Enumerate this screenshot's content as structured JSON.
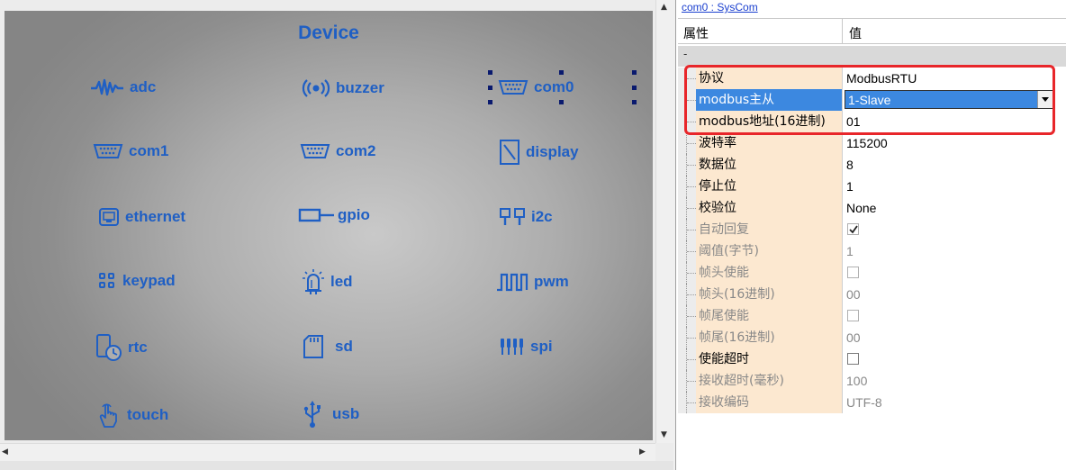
{
  "canvas": {
    "title": "Device",
    "devices": [
      {
        "id": "adc",
        "label": "adc",
        "icon": "waveform-icon"
      },
      {
        "id": "buzzer",
        "label": "buzzer",
        "icon": "speaker-icon"
      },
      {
        "id": "com0",
        "label": "com0",
        "icon": "serial-port-icon",
        "selected": true
      },
      {
        "id": "com1",
        "label": "com1",
        "icon": "serial-port-icon"
      },
      {
        "id": "com2",
        "label": "com2",
        "icon": "serial-port-icon"
      },
      {
        "id": "display",
        "label": "display",
        "icon": "display-icon"
      },
      {
        "id": "ethernet",
        "label": "ethernet",
        "icon": "ethernet-icon"
      },
      {
        "id": "gpio",
        "label": "gpio",
        "icon": "gpio-icon"
      },
      {
        "id": "i2c",
        "label": "i2c",
        "icon": "i2c-icon"
      },
      {
        "id": "keypad",
        "label": "keypad",
        "icon": "keypad-icon"
      },
      {
        "id": "led",
        "label": "led",
        "icon": "led-icon"
      },
      {
        "id": "pwm",
        "label": "pwm",
        "icon": "pwm-wave-icon"
      },
      {
        "id": "rtc",
        "label": "rtc",
        "icon": "clock-icon"
      },
      {
        "id": "sd",
        "label": "sd",
        "icon": "sd-card-icon"
      },
      {
        "id": "spi",
        "label": "spi",
        "icon": "spi-icon"
      },
      {
        "id": "touch",
        "label": "touch",
        "icon": "touch-hand-icon"
      },
      {
        "id": "usb",
        "label": "usb",
        "icon": "usb-icon"
      }
    ]
  },
  "property_grid": {
    "object_link": "com0 : SysCom",
    "header": {
      "name_col": "属性",
      "value_col": "值"
    },
    "category_label": "-",
    "rows": [
      {
        "name": "协议",
        "value": "ModbusRTU",
        "type": "text"
      },
      {
        "name": "modbus主从",
        "value": "1-Slave",
        "type": "dropdown",
        "selected": true
      },
      {
        "name": "modbus地址(16进制)",
        "value": "01",
        "type": "text"
      },
      {
        "name": "波特率",
        "value": "115200",
        "type": "text"
      },
      {
        "name": "数据位",
        "value": "8",
        "type": "text"
      },
      {
        "name": "停止位",
        "value": "1",
        "type": "text"
      },
      {
        "name": "校验位",
        "value": "None",
        "type": "text"
      },
      {
        "name": "自动回复",
        "value": "",
        "type": "checkbox",
        "checked": true,
        "disabled": true
      },
      {
        "name": "阈值(字节)",
        "value": "1",
        "type": "text",
        "disabled": true
      },
      {
        "name": "帧头使能",
        "value": "",
        "type": "checkbox",
        "checked": false,
        "disabled": true
      },
      {
        "name": "帧头(16进制)",
        "value": "00",
        "type": "text",
        "disabled": true
      },
      {
        "name": "帧尾使能",
        "value": "",
        "type": "checkbox",
        "checked": false,
        "disabled": true
      },
      {
        "name": "帧尾(16进制)",
        "value": "00",
        "type": "text",
        "disabled": true
      },
      {
        "name": "使能超时",
        "value": "",
        "type": "checkbox",
        "checked": false,
        "disabled": false
      },
      {
        "name": "接收超时(毫秒)",
        "value": "100",
        "type": "text",
        "disabled": true
      },
      {
        "name": "接收编码",
        "value": "UTF-8",
        "type": "text",
        "disabled": true
      }
    ]
  },
  "colors": {
    "accent": "#1f5fc4",
    "selection": "#3c88e0",
    "highlight": "#e8262a",
    "row_name_bg": "#fce8d0"
  }
}
